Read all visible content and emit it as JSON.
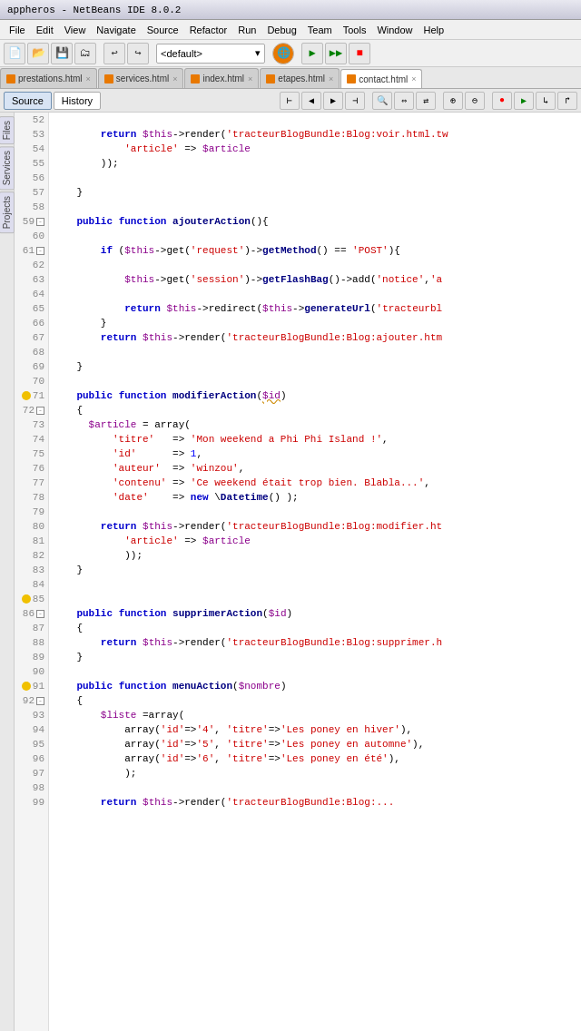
{
  "titlebar": {
    "text": "appheros - NetBeans IDE 8.0.2"
  },
  "menubar": {
    "items": [
      "File",
      "Edit",
      "View",
      "Navigate",
      "Source",
      "Refactor",
      "Run",
      "Debug",
      "Team",
      "Tools",
      "Window",
      "Help"
    ]
  },
  "toolbar": {
    "dropdown_value": "<default>"
  },
  "tabs": [
    {
      "label": "prestations.html",
      "active": false
    },
    {
      "label": "services.html",
      "active": false
    },
    {
      "label": "index.html",
      "active": false
    },
    {
      "label": "etapes.html",
      "active": false
    },
    {
      "label": "contact.html",
      "active": true
    }
  ],
  "source_bar": {
    "source_label": "Source",
    "history_label": "History"
  },
  "left_panels": [
    "Files",
    "Services",
    "Projects"
  ],
  "code": {
    "lines": [
      {
        "num": 52,
        "indent": 0,
        "content": ""
      },
      {
        "num": 53,
        "indent": 3,
        "content": "return $this->render('tracteurBlogBundle:Blog:voir.html.tw"
      },
      {
        "num": 54,
        "indent": 4,
        "content": "'article' => $article"
      },
      {
        "num": 55,
        "indent": 3,
        "content": "));"
      },
      {
        "num": 56,
        "indent": 0,
        "content": ""
      },
      {
        "num": 57,
        "indent": 2,
        "content": "}"
      },
      {
        "num": 58,
        "indent": 0,
        "content": ""
      },
      {
        "num": 59,
        "fold": true,
        "indent": 1,
        "content": "public function ajouterAction(){"
      },
      {
        "num": 60,
        "indent": 0,
        "content": ""
      },
      {
        "num": 61,
        "fold": true,
        "indent": 2,
        "content": "if ($this->get('request')->getMethod() == 'POST'){"
      },
      {
        "num": 62,
        "indent": 0,
        "content": ""
      },
      {
        "num": 63,
        "indent": 3,
        "content": "$this->get('session')->getFlashBag()->add('notice','a"
      },
      {
        "num": 64,
        "indent": 0,
        "content": ""
      },
      {
        "num": 65,
        "indent": 3,
        "content": "return $this->redirect($this->generateUrl('tracteurbl"
      },
      {
        "num": 66,
        "indent": 2,
        "content": "}"
      },
      {
        "num": 67,
        "indent": 2,
        "content": "return $this->render('tracteurBlogBundle:Blog:ajouter.htm"
      },
      {
        "num": 68,
        "indent": 0,
        "content": ""
      },
      {
        "num": 69,
        "indent": 1,
        "content": "}"
      },
      {
        "num": 70,
        "indent": 0,
        "content": ""
      },
      {
        "num": 71,
        "warn": true,
        "indent": 1,
        "content": "public function modifierAction($id)"
      },
      {
        "num": 72,
        "fold": true,
        "indent": 1,
        "content": "{"
      },
      {
        "num": 73,
        "indent": 2,
        "content": "$article = array("
      },
      {
        "num": 74,
        "indent": 3,
        "content": "'titre'   => 'Mon weekend a Phi Phi Island !',"
      },
      {
        "num": 75,
        "indent": 3,
        "content": "'id'      => 1,"
      },
      {
        "num": 76,
        "indent": 3,
        "content": "'auteur'  => 'winzou',"
      },
      {
        "num": 77,
        "indent": 3,
        "content": "'contenu' => 'Ce weekend était trop bien. Blabla...',"
      },
      {
        "num": 78,
        "indent": 3,
        "content": "'date'    => new \\Datetime() );"
      },
      {
        "num": 79,
        "indent": 0,
        "content": ""
      },
      {
        "num": 80,
        "indent": 2,
        "content": "return $this->render('tracteurBlogBundle:Blog:modifier.ht"
      },
      {
        "num": 81,
        "indent": 3,
        "content": "'article' => $article"
      },
      {
        "num": 82,
        "indent": 3,
        "content": "));"
      },
      {
        "num": 83,
        "indent": 2,
        "content": "}"
      },
      {
        "num": 84,
        "indent": 0,
        "content": ""
      },
      {
        "num": 85,
        "warn": true,
        "indent": 0,
        "content": ""
      },
      {
        "num": 86,
        "fold": true,
        "indent": 1,
        "content": "public function supprimerAction($id)"
      },
      {
        "num": 87,
        "indent": 2,
        "content": "{"
      },
      {
        "num": 88,
        "indent": 2,
        "content": "return $this->render('tracteurBlogBundle:Blog:supprimer.h"
      },
      {
        "num": 89,
        "indent": 1,
        "content": "}"
      },
      {
        "num": 90,
        "indent": 0,
        "content": ""
      },
      {
        "num": 91,
        "warn": true,
        "indent": 1,
        "content": "public function menuAction($nombre)"
      },
      {
        "num": 92,
        "fold": true,
        "indent": 1,
        "content": "{"
      },
      {
        "num": 93,
        "indent": 2,
        "content": "$liste =array("
      },
      {
        "num": 94,
        "indent": 3,
        "content": "array('id'=>'4', 'titre'=>'Les poney en hiver'),"
      },
      {
        "num": 95,
        "indent": 3,
        "content": "array('id'=>'5', 'titre'=>'Les poney en automne'),"
      },
      {
        "num": 96,
        "indent": 3,
        "content": "array('id'=>'6', 'titre'=>'Les poney en été'),"
      },
      {
        "num": 97,
        "indent": 3,
        "content": ");"
      },
      {
        "num": 98,
        "indent": 0,
        "content": ""
      },
      {
        "num": 99,
        "indent": 2,
        "content": "return $this->render('tracteurBlogBundle:Blog:..."
      }
    ]
  }
}
